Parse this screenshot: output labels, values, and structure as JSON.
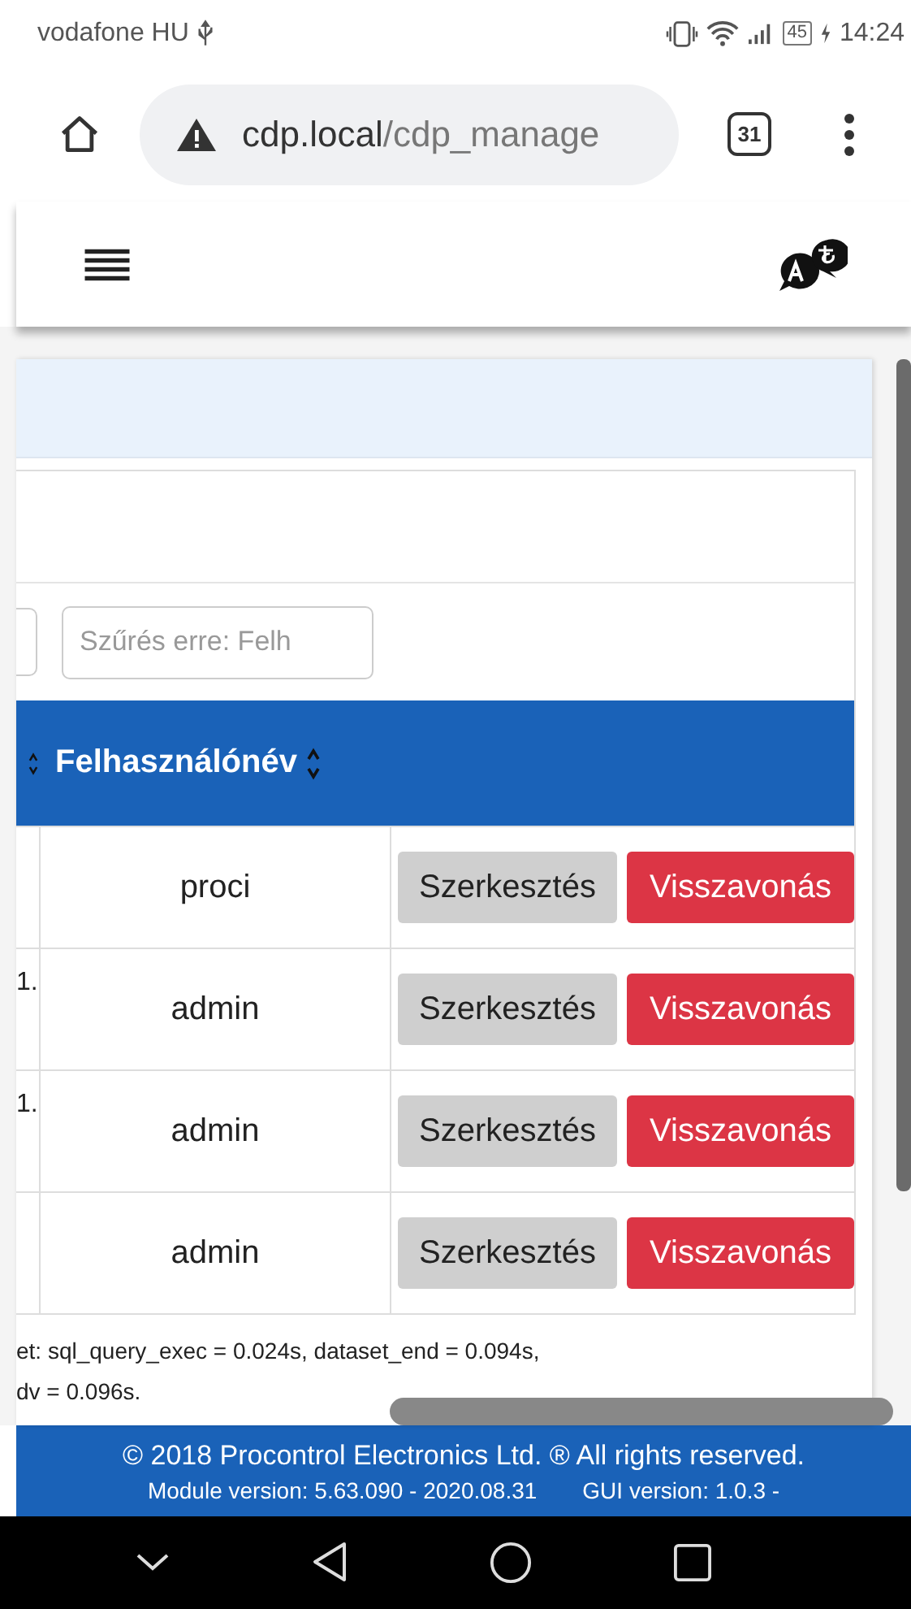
{
  "status_bar": {
    "carrier": "vodafone HU",
    "battery": "45",
    "time": "14:24"
  },
  "browser": {
    "url_host": "cdp.local",
    "url_path": "/cdp_manage",
    "tab_count": "31"
  },
  "filter": {
    "placeholder": "Szűrés erre: Felh"
  },
  "table": {
    "columns": [
      {
        "sortable": true
      },
      {
        "label": "Felhasználónév",
        "sortable": true
      }
    ],
    "rows": [
      {
        "username": "proci",
        "actions": [
          {
            "kind": "edit",
            "label": "Szerkesztés"
          },
          {
            "kind": "revoke",
            "label": "Visszavonás"
          }
        ]
      },
      {
        "column_1": "1.",
        "username": "admin",
        "actions": [
          {
            "kind": "edit",
            "label": "Szerkesztés"
          },
          {
            "kind": "revoke",
            "label": "Visszavonás"
          }
        ]
      },
      {
        "column_1": "1.",
        "username": "admin",
        "actions": [
          {
            "kind": "edit",
            "label": "Szerkesztés"
          },
          {
            "kind": "revoke",
            "label": "Visszavonás"
          }
        ]
      },
      {
        "username": "admin",
        "actions": [
          {
            "kind": "edit",
            "label": "Szerkesztés"
          },
          {
            "kind": "revoke",
            "label": "Visszavonás"
          }
        ]
      }
    ]
  },
  "timing_note": [
    "et: sql_query_exec = 0.024s, dataset_end = 0.094s,",
    "dv = 0.096s."
  ],
  "footer": {
    "copyright": "© 2018 Procontrol Electronics Ltd. ® All rights reserved.",
    "module_version": "Module version: 5.63.090 - 2020.08.31",
    "gui_version": "GUI version: 1.0.3 -"
  }
}
